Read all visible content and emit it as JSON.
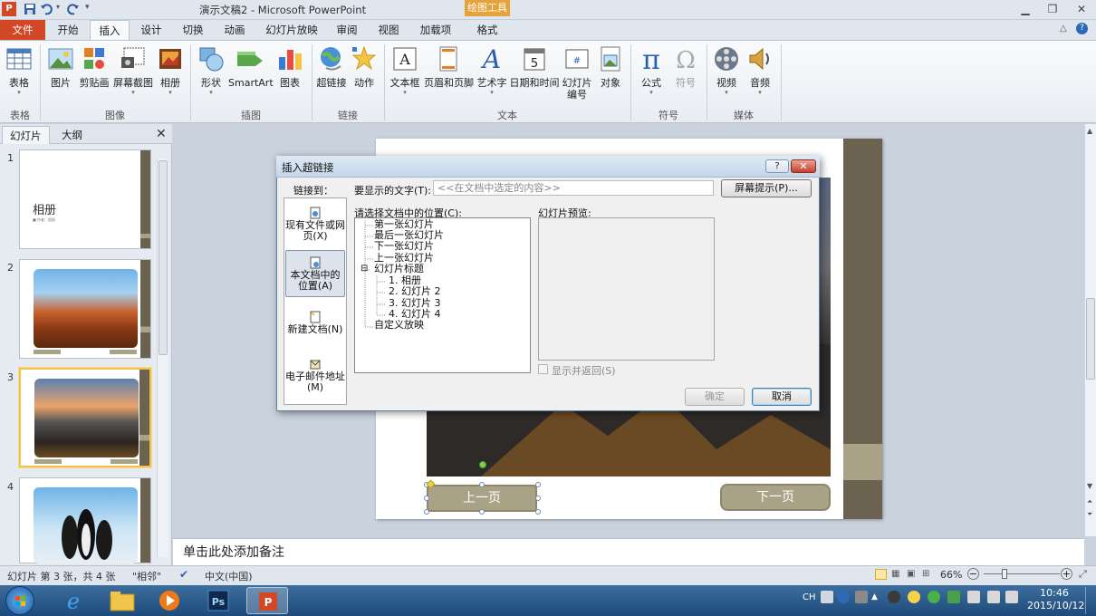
{
  "window": {
    "title": "演示文稿2 - Microsoft PowerPoint",
    "context_tool": "绘图工具",
    "logo": "P"
  },
  "tabs": [
    "文件",
    "开始",
    "插入",
    "设计",
    "切换",
    "动画",
    "幻灯片放映",
    "审阅",
    "视图",
    "加载项",
    "格式"
  ],
  "ribbon": {
    "groups": [
      {
        "label": "表格",
        "buttons": [
          "表格"
        ]
      },
      {
        "label": "图像",
        "buttons": [
          "图片",
          "剪贴画",
          "屏幕截图",
          "相册"
        ]
      },
      {
        "label": "插图",
        "buttons": [
          "形状",
          "SmartArt",
          "图表"
        ]
      },
      {
        "label": "链接",
        "buttons": [
          "超链接",
          "动作"
        ]
      },
      {
        "label": "文本",
        "buttons": [
          "文本框",
          "页眉和页脚",
          "艺术字",
          "日期和时间",
          "幻灯片\n编号",
          "对象"
        ]
      },
      {
        "label": "符号",
        "buttons": [
          "公式",
          "符号"
        ]
      },
      {
        "label": "媒体",
        "buttons": [
          "视频",
          "音频"
        ]
      }
    ]
  },
  "left_pane": {
    "tabs": [
      "幻灯片",
      "大纲"
    ],
    "slides": [
      {
        "num": "1",
        "title": "相册",
        "subtitle": "■ 作者：相册"
      },
      {
        "num": "2"
      },
      {
        "num": "3"
      },
      {
        "num": "4"
      }
    ]
  },
  "slide": {
    "prev_label": "上一页",
    "next_label": "下一页"
  },
  "notes": {
    "placeholder": "单击此处添加备注"
  },
  "status": {
    "slide_info": "幻灯片 第 3 张，共 4 张",
    "theme": "\"相邻\"",
    "language": "中文(中国)",
    "zoom": "66%"
  },
  "taskbar": {
    "time": "10:46",
    "date": "2015/10/12",
    "ime": "CH"
  },
  "dialog": {
    "title": "插入超链接",
    "help": "?",
    "close": "✕",
    "link_to_label": "链接到：",
    "link_to_items": [
      {
        "label": "现有文件或网页(X)",
        "icon": "web-page-icon",
        "selected": false
      },
      {
        "label": "本文档中的位置(A)",
        "icon": "document-place-icon",
        "selected": true
      },
      {
        "label": "新建文档(N)",
        "icon": "new-document-icon",
        "selected": false
      },
      {
        "label": "电子邮件地址(M)",
        "icon": "email-icon",
        "selected": false
      }
    ],
    "display_text_label": "要显示的文字(T):",
    "display_text_value": "<<在文档中选定的内容>>",
    "screentip_button": "屏幕提示(P)...",
    "place_label": "请选择文档中的位置(C):",
    "tree": [
      {
        "label": "第一张幻灯片",
        "level": 0
      },
      {
        "label": "最后一张幻灯片",
        "level": 0
      },
      {
        "label": "下一张幻灯片",
        "level": 0
      },
      {
        "label": "上一张幻灯片",
        "level": 0
      },
      {
        "label": "幻灯片标题",
        "level": 0,
        "expander": "⊟"
      },
      {
        "label": "1. 相册",
        "level": 1
      },
      {
        "label": "2. 幻灯片 2",
        "level": 1
      },
      {
        "label": "3. 幻灯片 3",
        "level": 1
      },
      {
        "label": "4. 幻灯片 4",
        "level": 1
      },
      {
        "label": "自定义放映",
        "level": 0
      }
    ],
    "preview_label": "幻灯片预览:",
    "show_return_label": "显示并返回(S)",
    "ok_button": "确定",
    "cancel_button": "取消"
  }
}
